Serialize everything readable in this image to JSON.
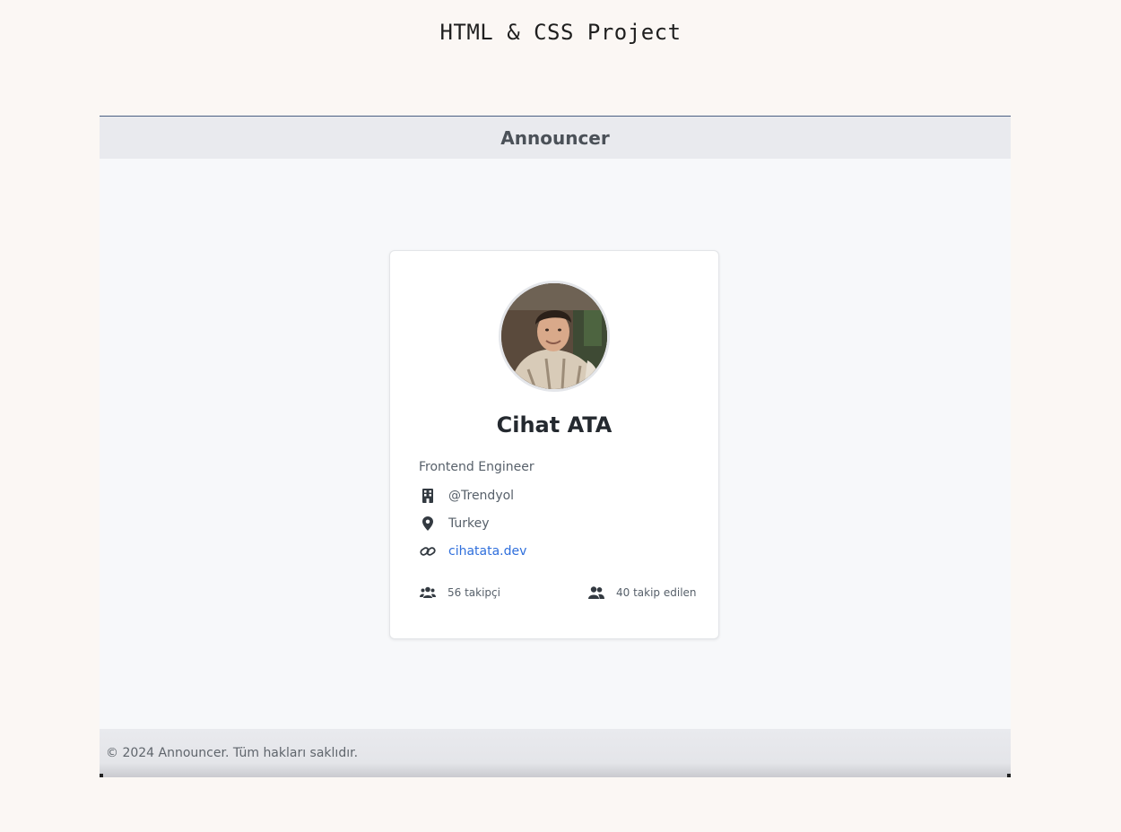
{
  "page": {
    "title": "HTML & CSS Project"
  },
  "header": {
    "title": "Announcer"
  },
  "profile": {
    "name": "Cihat ATA",
    "role": "Frontend Engineer",
    "company": "@Trendyol",
    "location": "Turkey",
    "website": "cihatata.dev",
    "followers": "56 takipçi",
    "following": "40 takip edilen",
    "avatar_icon": "profile-photo",
    "icons": {
      "company": "building-icon",
      "location": "map-pin-icon",
      "website": "link-icon",
      "followers": "users-icon",
      "following": "user-group-icon"
    }
  },
  "footer": {
    "text": "© 2024 Announcer. Tüm hakları saklıdır."
  },
  "colors": {
    "background": "#fbf7f4",
    "frame": "#f7f8fa",
    "header": "#e9eaee",
    "link": "#2f6fdc",
    "text_muted": "#57606a",
    "name": "#24292f"
  }
}
